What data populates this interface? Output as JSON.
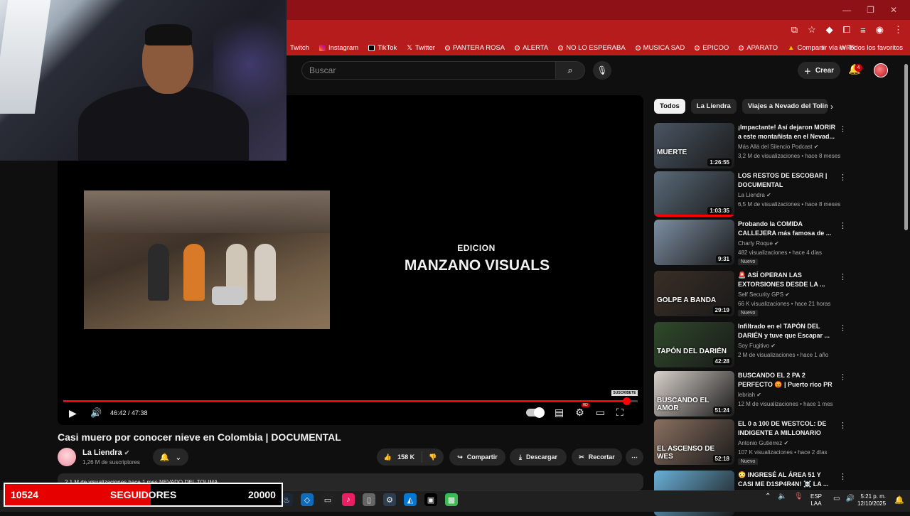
{
  "window": {
    "controls": [
      "—",
      "❐",
      "✕"
    ]
  },
  "bookmarks": {
    "items": [
      {
        "label": "Twitch",
        "icon": "twitch-icon"
      },
      {
        "label": "Instagram",
        "icon": "instagram-icon"
      },
      {
        "label": "TikTok",
        "icon": "tiktok-icon"
      },
      {
        "label": "Twitter",
        "icon": "x-icon"
      },
      {
        "label": "PANTERA ROSA",
        "icon": "youtube-icon"
      },
      {
        "label": "ALERTA",
        "icon": "youtube-icon"
      },
      {
        "label": "NO LO ESPERABA",
        "icon": "youtube-icon"
      },
      {
        "label": "MUSICA SAD",
        "icon": "youtube-icon"
      },
      {
        "label": "EPICOO",
        "icon": "youtube-icon"
      },
      {
        "label": "APARATO",
        "icon": "youtube-icon"
      },
      {
        "label": "Compartir vía Wi-Fi",
        "icon": "wifi-share-icon"
      }
    ],
    "overflow": "»",
    "all_favorites": "Todos los favoritos"
  },
  "header": {
    "search_placeholder": "Buscar",
    "create_label": "Crear",
    "notifications_count": "4"
  },
  "player": {
    "overlay_line1": "EDICION",
    "overlay_line2": "MANZANO VISUALS",
    "time": "46:42 / 47:38",
    "progress": 0.98,
    "subscribe_logo": "SUSCRIBETE"
  },
  "video": {
    "title": "Casi muero por conocer nieve en Colombia | DOCUMENTAL",
    "channel": "La Liendra",
    "subscribers": "1,26 M de suscriptores",
    "likes": "158 K",
    "share": "Compartir",
    "download": "Descargar",
    "clip": "Recortar",
    "description_partial": "2,1 M de visualizaciones  hace 1 mes  NEVADO DEL TOLIMA"
  },
  "sidebar": {
    "chips": [
      "Todos",
      "La Liendra",
      "Viajes a Nevado del Tolima"
    ],
    "recommendations": [
      {
        "title": "¡Impactante! Así dejaron MORIR a este montañista en el Nevad...",
        "channel": "Más Allá del Silencio Podcast",
        "meta": "3,2 M de visualizaciones • hace 8 meses",
        "duration": "1:26:55",
        "thumb_text": "MUERTE",
        "thumb_color": "#4a5563",
        "new": false,
        "watched": 0
      },
      {
        "title": "LOS RESTOS DE ESCOBAR | DOCUMENTAL",
        "channel": "La Liendra",
        "meta": "6,5 M de visualizaciones • hace 8 meses",
        "duration": "1:03:35",
        "thumb_text": "",
        "thumb_color": "#5a6b7a",
        "new": false,
        "watched": 1.0
      },
      {
        "title": "Probando la COMIDA CALLEJERA más famosa de ...",
        "channel": "Charly Roque",
        "meta": "482 visualizaciones • hace 4 días",
        "duration": "9:31",
        "thumb_text": "",
        "thumb_color": "#7d8fa3",
        "new": true,
        "watched": 0
      },
      {
        "title": "🚨 ASÍ OPERAN LAS EXTORSIONES DESDE LA ...",
        "channel": "Self Security GPS",
        "meta": "66 K visualizaciones • hace 21 horas",
        "duration": "29:19",
        "thumb_text": "GOLPE A BANDA",
        "thumb_color": "#3a2e26",
        "new": true,
        "watched": 0
      },
      {
        "title": "Infiltrado en el TAPÓN DEL DARIÉN y tuve que Escapar ...",
        "channel": "Soy Fugitivo",
        "meta": "2 M de visualizaciones • hace 1 año",
        "duration": "42:28",
        "thumb_text": "TAPÓN DEL DARIÉN",
        "thumb_color": "#2f4a2a",
        "new": false,
        "watched": 0
      },
      {
        "title": "BUSCANDO EL 2 PA 2 PERFECTO 😡 | Puerto rico PR",
        "channel": "lebriah",
        "meta": "12 M de visualizaciones • hace 1 mes",
        "duration": "51:24",
        "thumb_text": "BUSCANDO EL AMOR",
        "thumb_color": "#d9d2cc",
        "new": false,
        "watched": 0
      },
      {
        "title": "EL 0 a 100 DE WESTCOL: DE INDIGENTE A MILLONARIO",
        "channel": "Antonio Gutiérrez",
        "meta": "107 K visualizaciones • hace 2 días",
        "duration": "52:18",
        "thumb_text": "EL ASCENSO DE WES",
        "thumb_color": "#8a7060",
        "new": true,
        "watched": 0
      },
      {
        "title": "😳 INGRESÉ AL ÁREA 51 Y CASI ME D1SP4R4N! ☠️ LA ...",
        "channel": "",
        "meta": "",
        "duration": "",
        "thumb_text": "",
        "thumb_color": "#6ab0d8",
        "new": false,
        "watched": 0
      }
    ]
  },
  "overlay": {
    "followers": "10524",
    "label": "SEGUIDORES",
    "goal": "20000",
    "fill_fraction": 0.526
  },
  "taskbar": {
    "lang_top": "ESP",
    "lang_bottom": "LAA",
    "time": "5:21 p. m.",
    "date": "12/10/2025"
  }
}
